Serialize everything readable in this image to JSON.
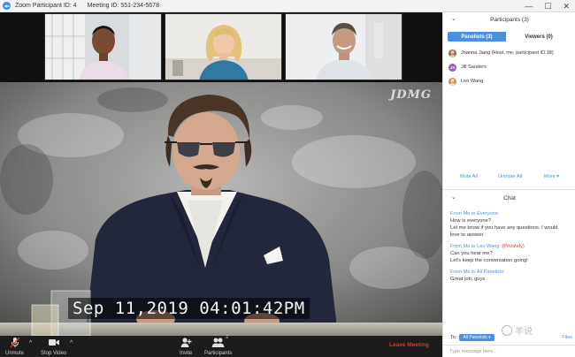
{
  "window": {
    "app_title": "Zoom Participant ID: 4",
    "meeting_id": "Meeting ID: 551-234-5678",
    "controls": [
      "—",
      "☐",
      "✕"
    ]
  },
  "video": {
    "watermark": "JDMG",
    "timestamp": "Sep 11,2019 04:01:42PM"
  },
  "toolbar": {
    "unmute": "Unmute",
    "stop_video": "Stop Video",
    "invite": "Invite",
    "participants": "Participants",
    "participants_count": "2",
    "leave": "Leave Meeting"
  },
  "participants_panel": {
    "title": "Participants (3)",
    "tabs": [
      {
        "label": "Panelists (3)",
        "active": true
      },
      {
        "label": "Viewers (0)",
        "active": false
      }
    ],
    "people": [
      {
        "name": "Joanna Jiang (Host, me, participant ID:18)",
        "initials": "",
        "color": "#8a6d5a"
      },
      {
        "name": "Jill Sanders",
        "initials": "JS",
        "color": "#9b59b6"
      },
      {
        "name": "Leo Wang",
        "initials": "",
        "color": "#c98b4d"
      }
    ],
    "actions": {
      "mute_all": "Mute All",
      "unmute_all": "Unmute All",
      "more": "More ▾"
    }
  },
  "chat": {
    "title": "Chat",
    "messages": [
      {
        "from": "From Me to Everyone:",
        "private": "",
        "lines": [
          "How is everyone?",
          "Let me know if you have any questions. I would",
          "love to answer."
        ]
      },
      {
        "from": "From Me to Leo Wang:",
        "private": "(Privately)",
        "lines": [
          "Can you hear me?",
          "Let's keep the conversation going!"
        ]
      },
      {
        "from": "From Me to All Panelists:",
        "private": "",
        "lines": [
          "Great job, guys"
        ]
      }
    ],
    "to_label": "To:",
    "to_value": "All Panelists ▾",
    "files": "Files",
    "watermark": "羊说",
    "placeholder": "Type message here..."
  }
}
